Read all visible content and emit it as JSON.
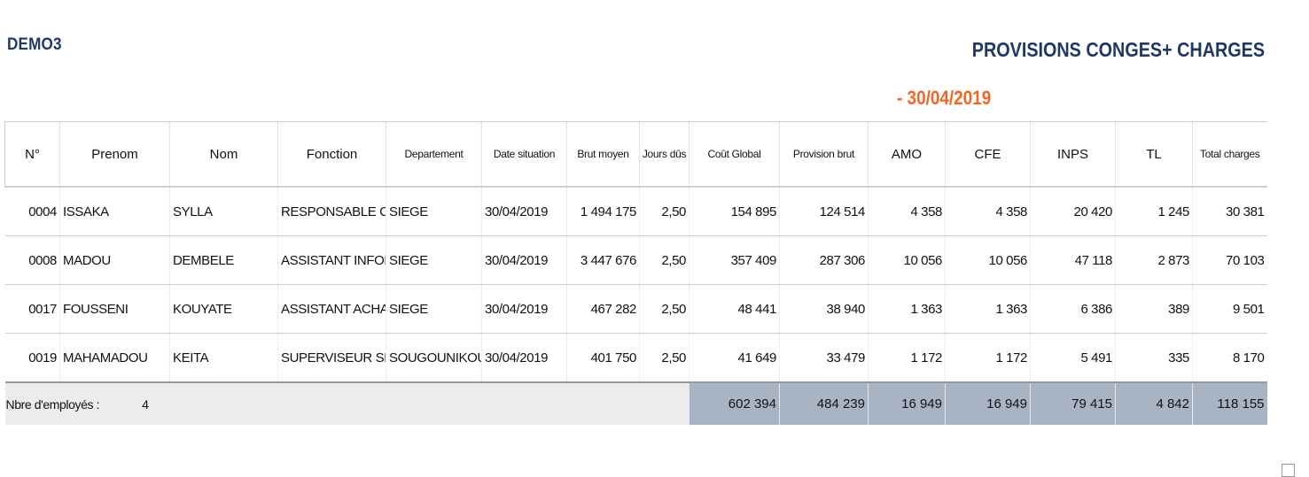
{
  "company": "DEMO3",
  "report_title": "PROVISIONS CONGES+ CHARGES",
  "report_date": "- 30/04/2019",
  "columns": [
    "N°",
    "Prenom",
    "Nom",
    "Fonction",
    "Departement",
    "Date situation",
    "Brut moyen",
    "Jours dûs",
    "Coût Global",
    "Provision brut",
    "AMO",
    "CFE",
    "INPS",
    "TL",
    "Total charges"
  ],
  "rows": [
    [
      "0004",
      "ISSAKA",
      "SYLLA",
      "RESPONSABLE C",
      "SIEGE",
      "30/04/2019",
      "1 494 175",
      "2,50",
      "154 895",
      "124 514",
      "4 358",
      "4 358",
      "20 420",
      "1 245",
      "30 381"
    ],
    [
      "0008",
      "MADOU",
      "DEMBELE",
      "ASSISTANT INFOR",
      "SIEGE",
      "30/04/2019",
      "3 447 676",
      "2,50",
      "357 409",
      "287 306",
      "10 056",
      "10 056",
      "47 118",
      "2 873",
      "70 103"
    ],
    [
      "0017",
      "FOUSSENI",
      "KOUYATE",
      "ASSISTANT ACHA",
      "SIEGE",
      "30/04/2019",
      "467 282",
      "2,50",
      "48 441",
      "38 940",
      "1 363",
      "1 363",
      "6 386",
      "389",
      "9 501"
    ],
    [
      "0019",
      "MAHAMADOU",
      "KEITA",
      "SUPERVISEUR SE",
      "SOUGOUNIKOU",
      "30/04/2019",
      "401 750",
      "2,50",
      "41 649",
      "33 479",
      "1 172",
      "1 172",
      "5 491",
      "335",
      "8 170"
    ]
  ],
  "footer": {
    "label": "Nbre d'employés :",
    "count": "4",
    "totals": [
      "602 394",
      "484 239",
      "16 949",
      "16 949",
      "79 415",
      "4 842",
      "118 155"
    ]
  }
}
